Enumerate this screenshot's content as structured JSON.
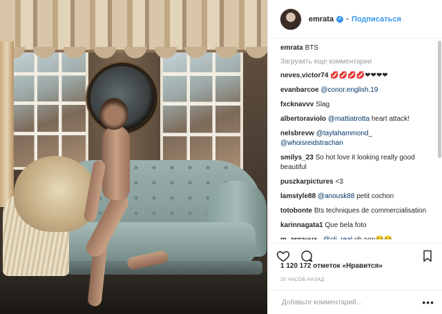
{
  "post": {
    "username": "emrata",
    "follow_label": "Подписаться",
    "likes_text": "1 120 172 отметок «Нравится»",
    "time_text": "20 ЧАСОВ НАЗАД",
    "add_comment_placeholder": "Добавьте комментарий...",
    "more_dots": "•••"
  },
  "caption": {
    "user": "emrata",
    "text": "BTS"
  },
  "load_more_label": "Загрузить еще комментарии",
  "comments": [
    {
      "user": "neves.victor74",
      "mention": "",
      "text": "💋💋💋💋❤❤❤❤"
    },
    {
      "user": "evanbarcoe",
      "mention": "@conor.english.19",
      "text": ""
    },
    {
      "user": "fxcknavvv",
      "mention": "",
      "text": "Slag"
    },
    {
      "user": "albertoraviolo",
      "mention": "@mattiatrotta",
      "text": "heart attack!"
    },
    {
      "user": "nelsbrevw",
      "mention": "@taylahammond_ @whoisreidstrachan",
      "text": ""
    },
    {
      "user": "smilys_23",
      "mention": "",
      "text": "So hot love it looking really good beautiful"
    },
    {
      "user": "puszkarpictures",
      "mention": "",
      "text": "<3"
    },
    {
      "user": "lamstyle88",
      "mention": "@anousk88",
      "text": "petit cochon"
    },
    {
      "user": "totobonte",
      "mention": "",
      "text": "Bts techniques de commercialisation"
    },
    {
      "user": "karinnagata1",
      "mention": "",
      "text": "Que bela foto"
    },
    {
      "user": "m_argauux_",
      "mention": "@oli_real",
      "text": "oh non😂😂"
    }
  ],
  "icons": [
    "heart-icon",
    "comment-icon",
    "bookmark-icon",
    "verified-badge-icon"
  ],
  "colors": {
    "accent": "#3897f0",
    "mention": "#003569",
    "muted": "#999999"
  }
}
